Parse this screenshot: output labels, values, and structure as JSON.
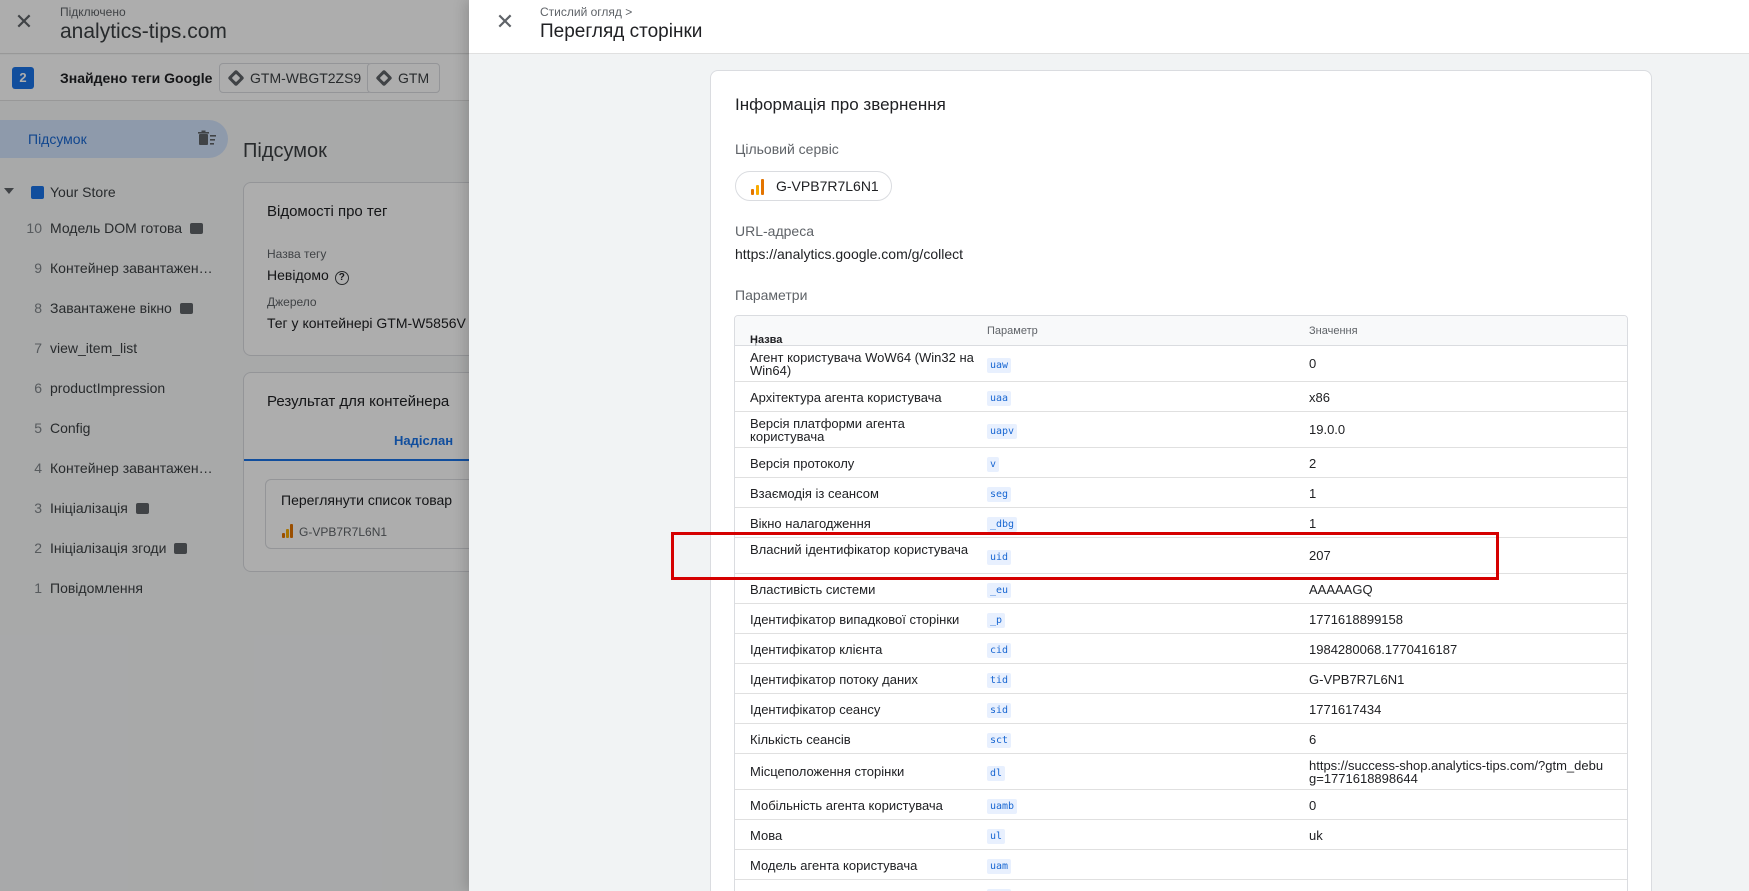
{
  "topbar": {
    "connected_label": "Підключено",
    "site": "analytics-tips.com"
  },
  "tagsbar": {
    "count": "2",
    "found_label": "Знайдено теги Google",
    "chips": [
      "GTM-WBGT2ZS9",
      "GTM"
    ]
  },
  "sidebar": {
    "summary_label": "Підсумок",
    "store_label": "Your Store",
    "events": [
      {
        "num": "10",
        "name": "Модель DOM готова",
        "code": true
      },
      {
        "num": "9",
        "name": "Контейнер завантажен…",
        "code": false
      },
      {
        "num": "8",
        "name": "Завантажене вікно",
        "code": true
      },
      {
        "num": "7",
        "name": "view_item_list",
        "code": false
      },
      {
        "num": "6",
        "name": "productImpression",
        "code": false
      },
      {
        "num": "5",
        "name": "Config",
        "code": false
      },
      {
        "num": "4",
        "name": "Контейнер завантажен…",
        "code": false
      },
      {
        "num": "3",
        "name": "Ініціалізація",
        "code": true
      },
      {
        "num": "2",
        "name": "Ініціалізація згоди",
        "code": true
      },
      {
        "num": "1",
        "name": "Повідомлення",
        "code": false
      }
    ]
  },
  "main": {
    "title": "Підсумок",
    "tag_card": {
      "heading": "Відомості про тег",
      "name_label": "Назва тегу",
      "name_value": "Невідомо",
      "source_label": "Джерело",
      "source_value": "Тег у контейнері GTM-W5856V"
    },
    "result_card": {
      "heading": "Результат для контейнера",
      "tab": "Надіслан",
      "item_title": "Переглянути список товар",
      "item_id": "G-VPB7R7L6N1"
    }
  },
  "panel": {
    "breadcrumb": "Стислий огляд >",
    "title": "Перегляд сторінки",
    "card_heading": "Інформація про звернення",
    "target_label": "Цільовий сервіс",
    "target_value": "G-VPB7R7L6N1",
    "url_label": "URL-адреса",
    "url_value": "https://analytics.google.com/g/collect",
    "params_label": "Параметри",
    "columns": {
      "name": "Назва",
      "param": "Параметр",
      "value": "Значення"
    },
    "rows": [
      {
        "name": "Агент користувача WoW64 (Win32 на Win64)",
        "param": "uaw",
        "value": "0"
      },
      {
        "name": "Архітектура агента користувача",
        "param": "uaa",
        "value": "x86"
      },
      {
        "name": "Версія платформи агента користувача",
        "param": "uapv",
        "value": "19.0.0"
      },
      {
        "name": "Версія протоколу",
        "param": "v",
        "value": "2"
      },
      {
        "name": "Взаємодія із сеансом",
        "param": "seg",
        "value": "1"
      },
      {
        "name": "Вікно налагодження",
        "param": "_dbg",
        "value": "1"
      },
      {
        "name": "Власний ідентифікатор користувача",
        "param": "uid",
        "value": "207"
      },
      {
        "name": "Властивість системи",
        "param": "_eu",
        "value": "AAAAAGQ"
      },
      {
        "name": "Ідентифікатор випадкової сторінки",
        "param": "_p",
        "value": "1771618899158"
      },
      {
        "name": "Ідентифікатор клієнта",
        "param": "cid",
        "value": "1984280068.1770416187"
      },
      {
        "name": "Ідентифікатор потоку даних",
        "param": "tid",
        "value": "G-VPB7R7L6N1"
      },
      {
        "name": "Ідентифікатор сеансу",
        "param": "sid",
        "value": "1771617434"
      },
      {
        "name": "Кількість сеансів",
        "param": "sct",
        "value": "6"
      },
      {
        "name": "Місцеположення сторінки",
        "param": "dl",
        "value": "https://success-shop.analytics-tips.com/?gtm_debug=1771618898644"
      },
      {
        "name": "Мобільність агента користувача",
        "param": "uamb",
        "value": "0"
      },
      {
        "name": "Мова",
        "param": "ul",
        "value": "uk"
      },
      {
        "name": "Модель агента користувача",
        "param": "uam",
        "value": ""
      },
      {
        "name": "",
        "param": "",
        "value": ""
      }
    ]
  }
}
